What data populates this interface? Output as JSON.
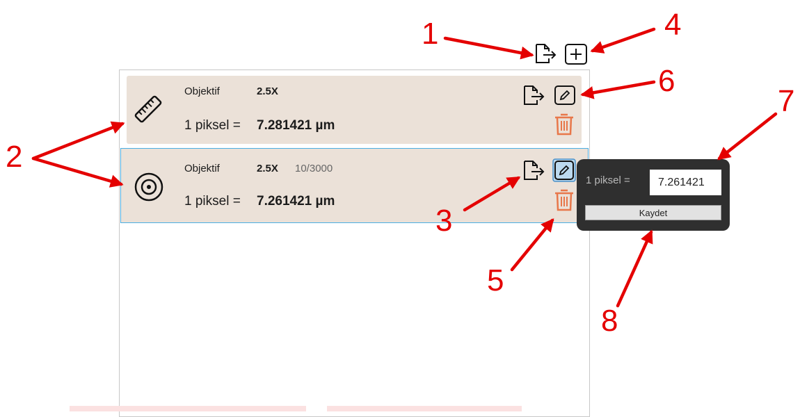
{
  "calibrations": [
    {
      "objective_label": "Objektif",
      "objective_value": "2.5X",
      "extra": "",
      "pixel_label": "1 piksel =",
      "pixel_value": "7.281421 µm",
      "icon": "ruler-icon"
    },
    {
      "objective_label": "Objektif",
      "objective_value": "2.5X",
      "extra": "10/3000",
      "pixel_label": "1 piksel =",
      "pixel_value": "7.261421 µm",
      "icon": "target-icon"
    }
  ],
  "editor": {
    "label": "1 piksel =",
    "value": "7.261421",
    "save_label": "Kaydet"
  },
  "annotations": [
    "1",
    "2",
    "3",
    "4",
    "5",
    "6",
    "7",
    "8"
  ],
  "colors": {
    "card_bg": "#ebe1d8",
    "selected_border": "#4aaee3",
    "trash": "#e8774a",
    "annotation": "#e40000",
    "popup_bg": "#2f2f2f"
  }
}
